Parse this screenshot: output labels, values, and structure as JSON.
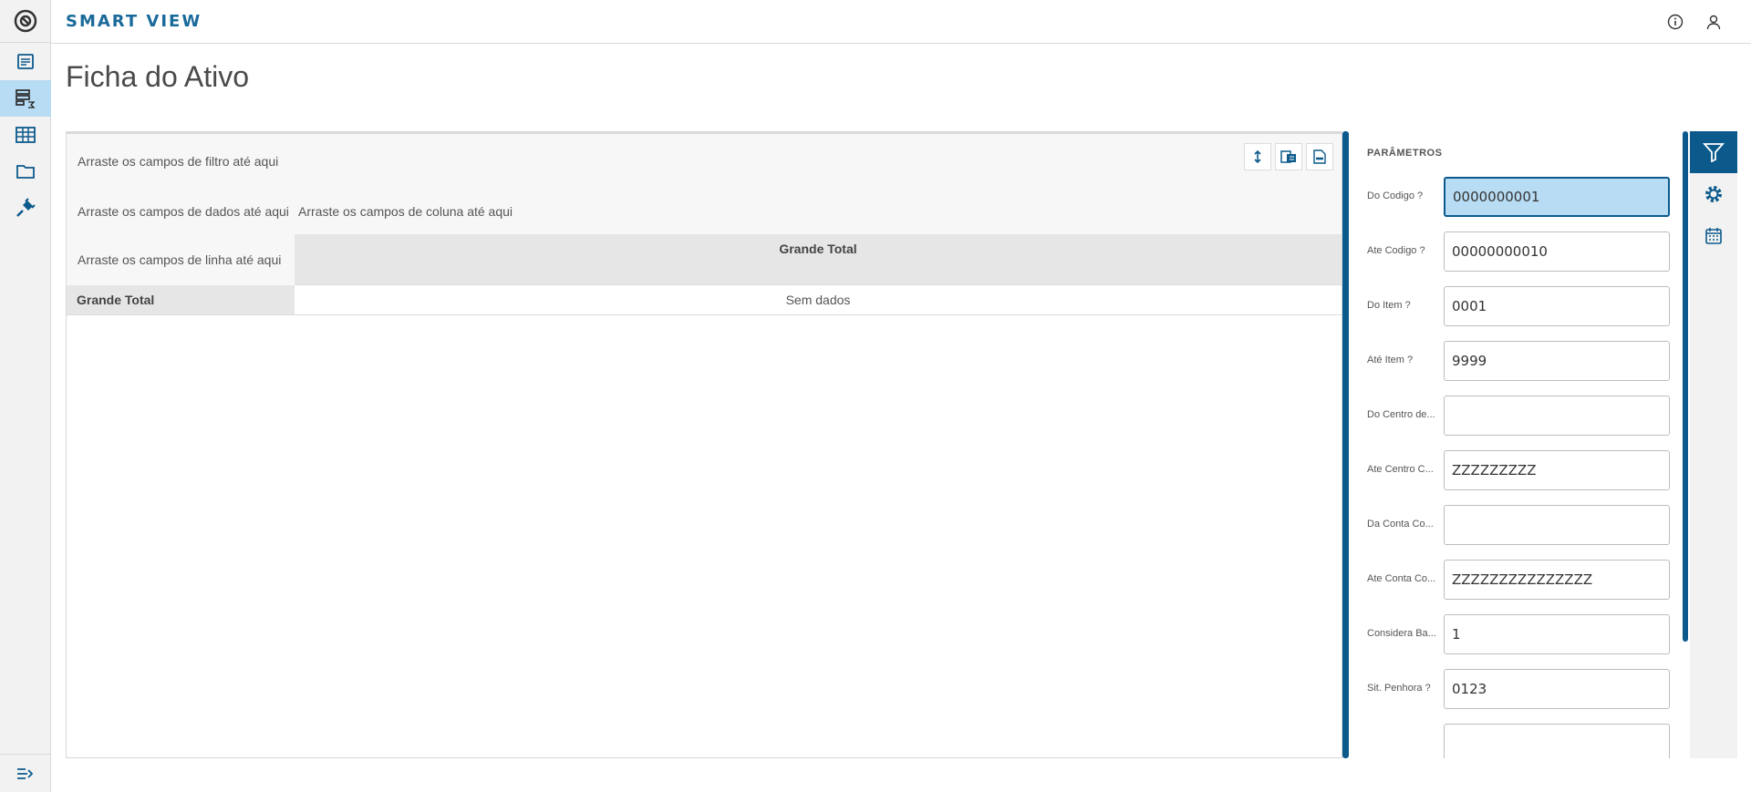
{
  "header": {
    "app_title": "SMART VIEW"
  },
  "page": {
    "title": "Ficha do Ativo"
  },
  "pivot": {
    "filter_zone": "Arraste os campos de filtro até aqui",
    "data_zone": "Arraste os campos de dados até aqui",
    "column_zone": "Arraste os campos de coluna até aqui",
    "row_zone": "Arraste os campos de linha até aqui",
    "column_header": "Grande Total",
    "row_total_label": "Grande Total",
    "empty_cell": "Sem dados"
  },
  "params": {
    "title": "PARÂMETROS",
    "fields": [
      {
        "label": "Do Codigo ?",
        "value": "0000000001"
      },
      {
        "label": "Ate Codigo ?",
        "value": "00000000010"
      },
      {
        "label": "Do Item ?",
        "value": "0001"
      },
      {
        "label": "Até Item ?",
        "value": "9999"
      },
      {
        "label": "Do Centro de...",
        "value": ""
      },
      {
        "label": "Ate Centro C...",
        "value": "ZZZZZZZZZ"
      },
      {
        "label": "Da Conta Co...",
        "value": ""
      },
      {
        "label": "Ate Conta Co...",
        "value": "ZZZZZZZZZZZZZZZ"
      },
      {
        "label": "Considera Ba...",
        "value": "1"
      },
      {
        "label": "Sit. Penhora ?",
        "value": "0123"
      }
    ]
  },
  "colors": {
    "accent": "#0c5a8c",
    "active_bg": "#b8dcf3",
    "brand": "#1a6a9a"
  }
}
